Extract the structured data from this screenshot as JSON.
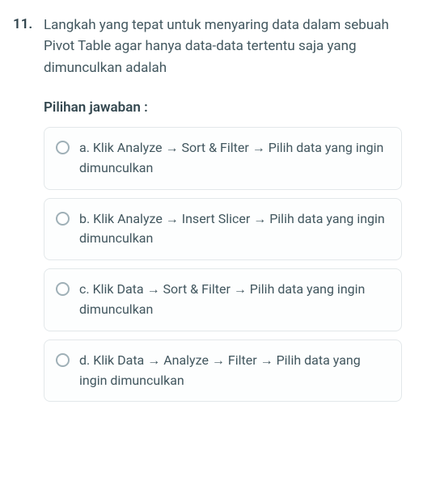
{
  "question": {
    "number": "11.",
    "text": "Langkah yang tepat untuk menyaring data dalam sebuah Pivot Table agar hanya data-data tertentu saja yang dimunculkan adalah"
  },
  "answers_heading": "Pilihan jawaban :",
  "options": [
    {
      "label": "a. Klik Analyze → Sort & Filter → Pilih data yang ingin dimunculkan"
    },
    {
      "label": "b. Klik Analyze → Insert Slicer → Pilih data yang ingin dimunculkan"
    },
    {
      "label": "c. Klik Data → Sort & Filter → Pilih data yang ingin dimunculkan"
    },
    {
      "label": "d. Klik Data → Analyze → Filter → Pilih data yang ingin dimunculkan"
    }
  ]
}
